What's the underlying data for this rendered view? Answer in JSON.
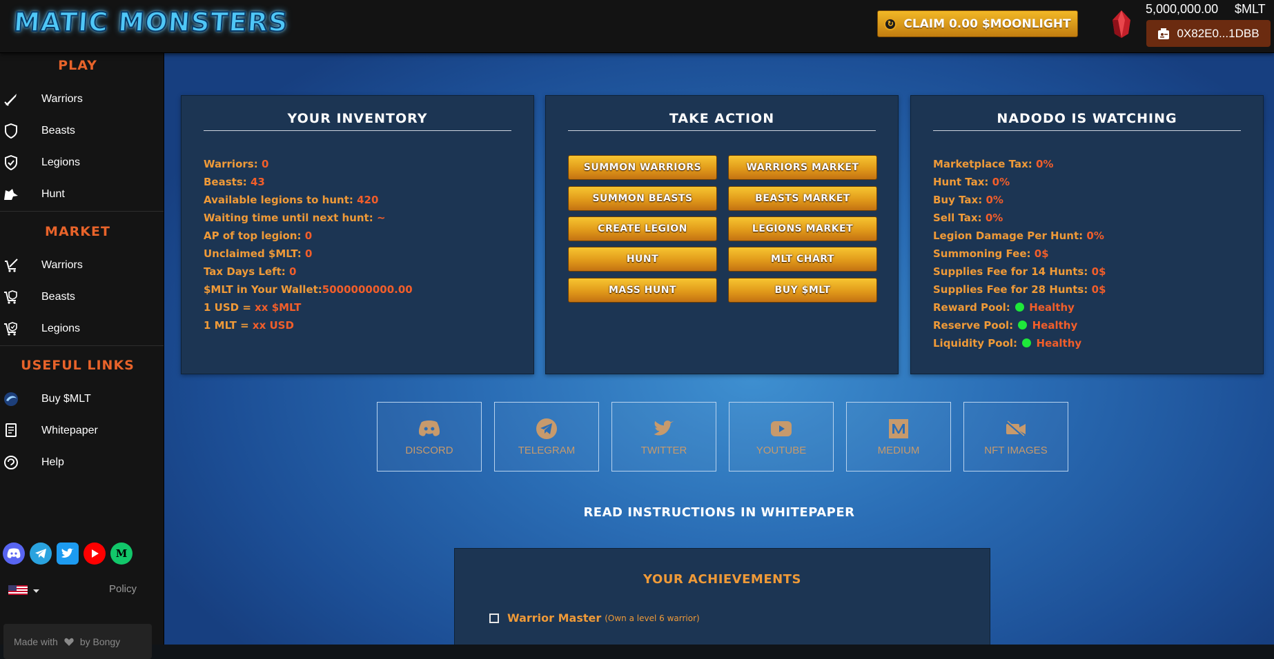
{
  "header": {
    "logo": "MATIC MONSTERS",
    "claim_label": "CLAIM 0.00 $MOONLIGHT",
    "balance": "5,000,000.00",
    "balance_unit": "$MLT",
    "wallet": "0X82E0...1DBB"
  },
  "sidebar": {
    "play_title": "PLAY",
    "play_items": [
      {
        "label": "Warriors",
        "icon": "sword-icon"
      },
      {
        "label": "Beasts",
        "icon": "shield-icon"
      },
      {
        "label": "Legions",
        "icon": "shield-check-icon"
      },
      {
        "label": "Hunt",
        "icon": "dragon-icon"
      }
    ],
    "market_title": "MARKET",
    "market_items": [
      {
        "label": "Warriors",
        "icon": "cart-sword-icon"
      },
      {
        "label": "Beasts",
        "icon": "cart-shield-icon"
      },
      {
        "label": "Legions",
        "icon": "cart-shield-check-icon"
      }
    ],
    "links_title": "USEFUL LINKS",
    "link_items": [
      {
        "label": "Buy $MLT",
        "icon": "quickswap-icon"
      },
      {
        "label": "Whitepaper",
        "icon": "document-icon"
      },
      {
        "label": "Help",
        "icon": "help-icon"
      }
    ],
    "social_letters": {
      "medium": "M"
    },
    "policy": "Policy",
    "made_with": "Made with",
    "made_by": "by Bongy"
  },
  "inventory": {
    "title": "YOUR INVENTORY",
    "rows": [
      {
        "label": "Warriors:",
        "value": "0"
      },
      {
        "label": "Beasts:",
        "value": "43"
      },
      {
        "label": "Available legions to hunt:",
        "value": "420"
      },
      {
        "label": "Waiting time until next hunt:",
        "value": "~"
      },
      {
        "label": "AP of top legion:",
        "value": "0"
      },
      {
        "label": "Unclaimed $MLT:",
        "value": "0"
      },
      {
        "label": "Tax Days Left:",
        "value": "0"
      },
      {
        "label": "$MLT in Your Wallet:",
        "value": "5000000000.00"
      },
      {
        "label": "1 USD =",
        "value": "xx $MLT"
      },
      {
        "label": "1 MLT =",
        "value": "xx USD"
      }
    ]
  },
  "actions": {
    "title": "TAKE ACTION",
    "buttons": [
      "SUMMON WARRIORS",
      "WARRIORS MARKET",
      "SUMMON BEASTS",
      "BEASTS MARKET",
      "CREATE LEGION",
      "LEGIONS MARKET",
      "HUNT",
      "MLT CHART",
      "MASS HUNT",
      "BUY $MLT"
    ]
  },
  "watching": {
    "title": "NADODO IS WATCHING",
    "rows": [
      {
        "label": "Marketplace Tax:",
        "value": "0%"
      },
      {
        "label": "Hunt Tax:",
        "value": "0%"
      },
      {
        "label": "Buy Tax:",
        "value": "0%"
      },
      {
        "label": "Sell Tax:",
        "value": "0%"
      },
      {
        "label": "Legion Damage Per Hunt:",
        "value": "0%"
      },
      {
        "label": "Summoning Fee:",
        "value": "0$"
      },
      {
        "label": "Supplies Fee for 14 Hunts:",
        "value": "0$"
      },
      {
        "label": "Supplies Fee for 28 Hunts:",
        "value": "0$"
      },
      {
        "label": "Reward Pool:",
        "value": "Healthy"
      },
      {
        "label": "Reserve Pool:",
        "value": "Healthy"
      },
      {
        "label": "Liquidity Pool:",
        "value": "Healthy"
      }
    ]
  },
  "socials": [
    "DISCORD",
    "TELEGRAM",
    "TWITTER",
    "YOUTUBE",
    "MEDIUM",
    "NFT IMAGES"
  ],
  "read_instructions": "READ INSTRUCTIONS IN WHITEPAPER",
  "achievements": {
    "title": "YOUR ACHIEVEMENTS",
    "items": [
      {
        "label": "Warrior Master",
        "sub": "(Own a level 6 warrior)"
      }
    ]
  },
  "colors": {
    "accent": "#e8632a",
    "gold": "#ef9a38",
    "healthy": "#1ee83a"
  }
}
